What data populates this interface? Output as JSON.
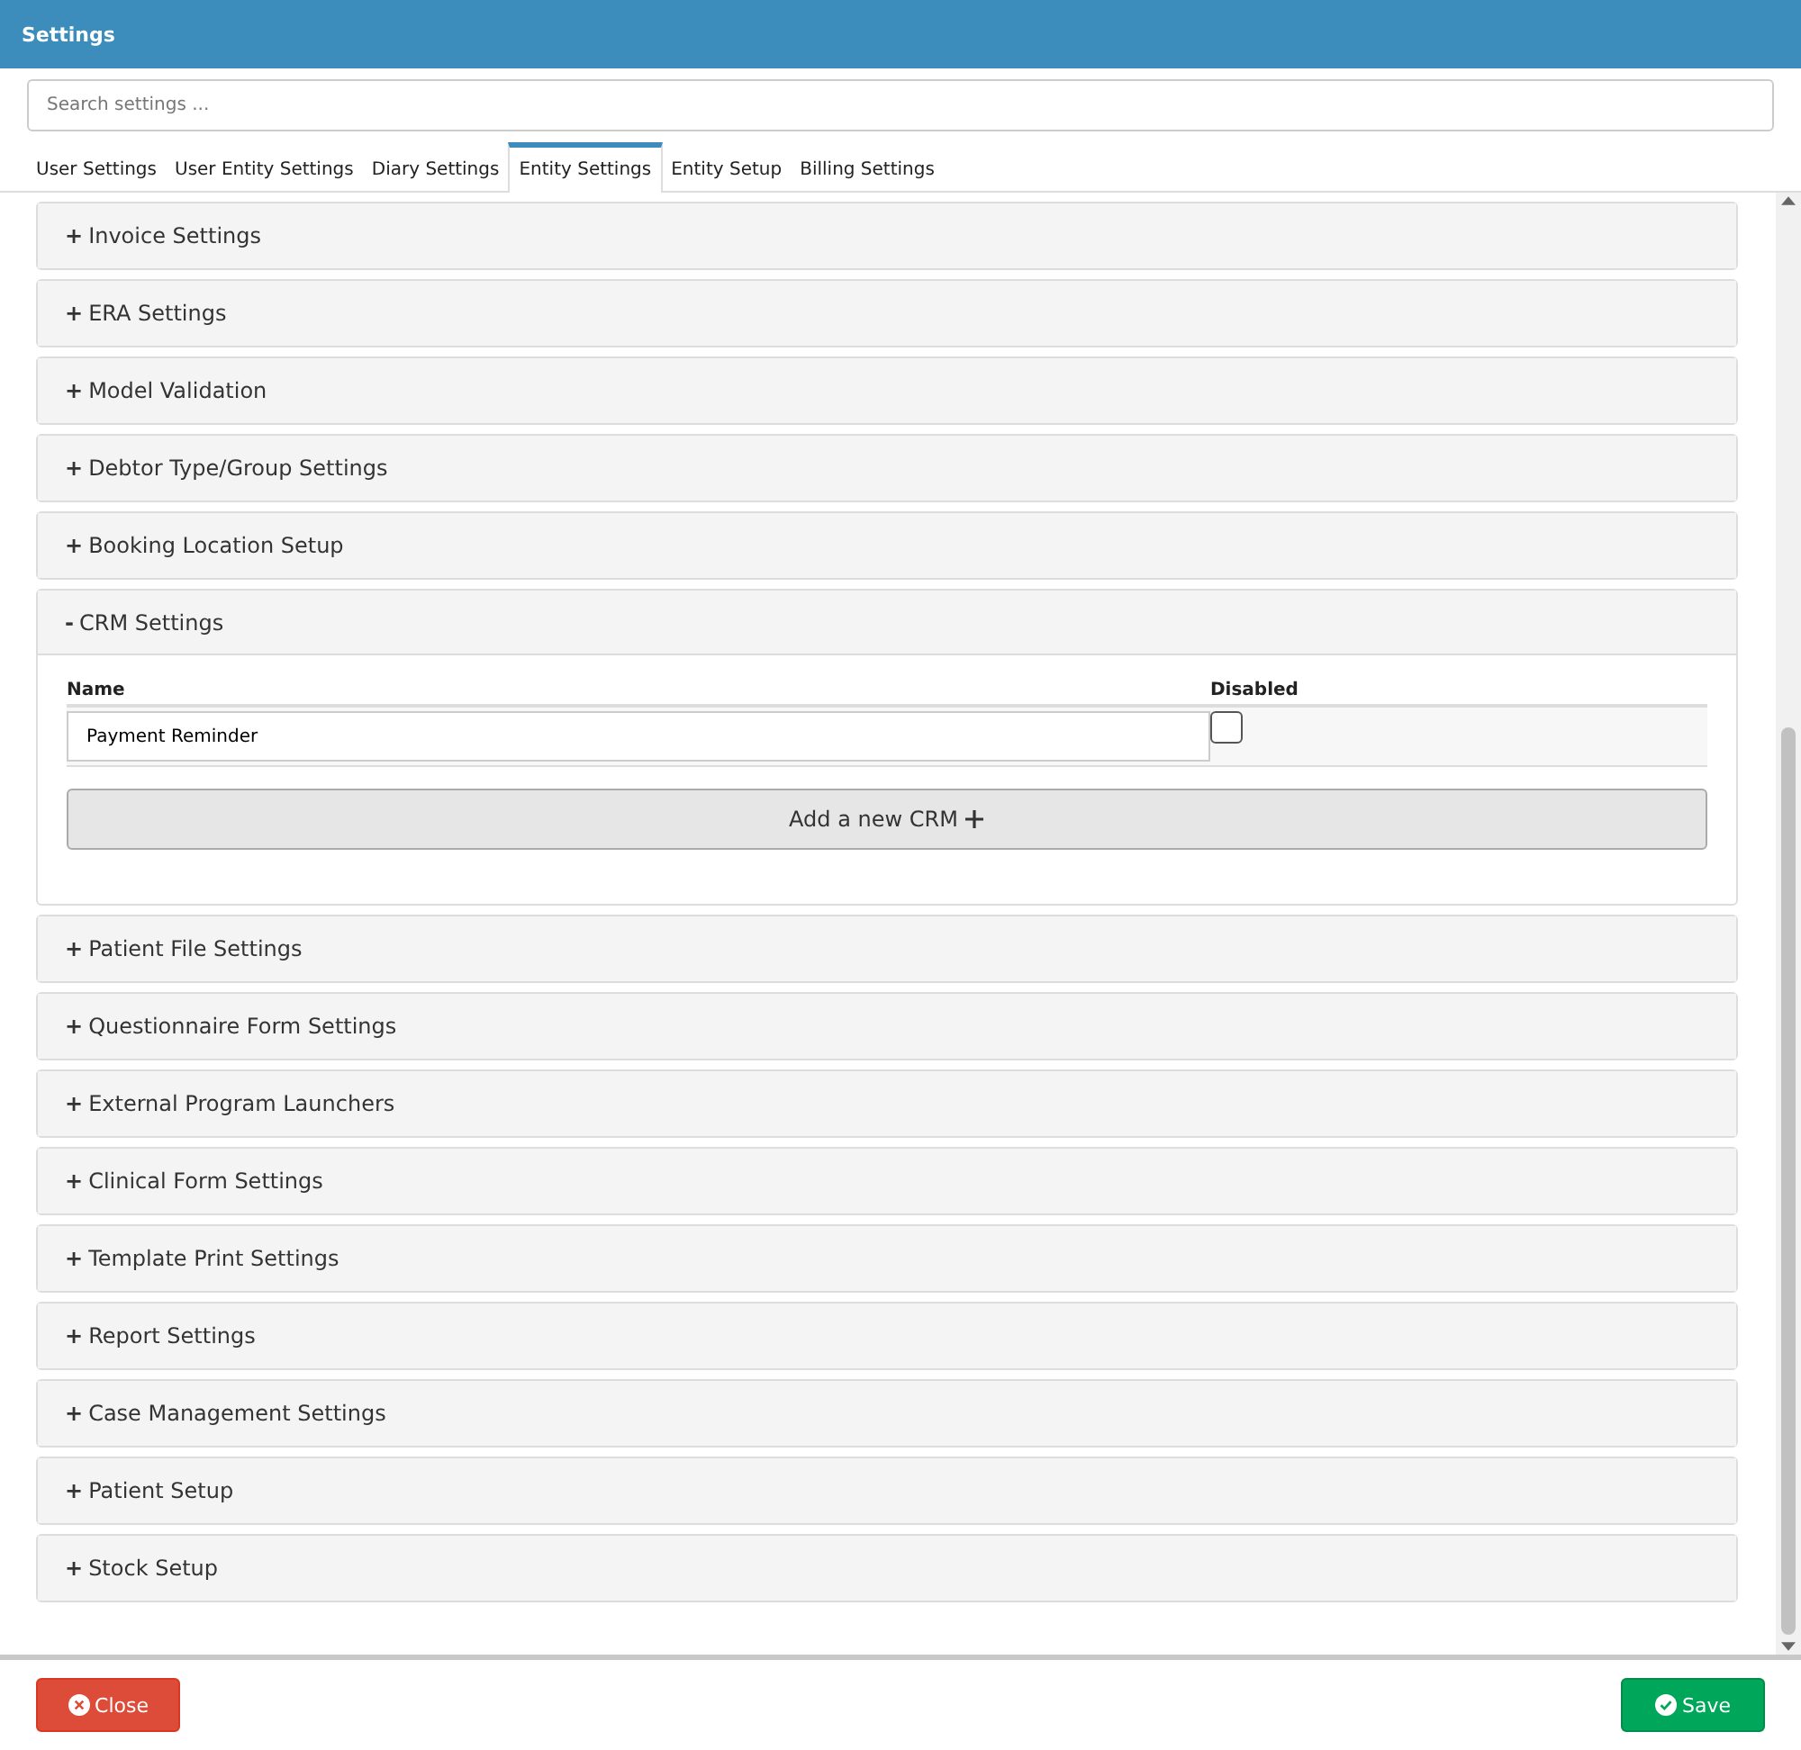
{
  "window": {
    "title": "Settings"
  },
  "search": {
    "placeholder": "Search settings ..."
  },
  "tabs": [
    {
      "label": "User Settings",
      "selected": false
    },
    {
      "label": "User Entity Settings",
      "selected": false
    },
    {
      "label": "Diary Settings",
      "selected": false
    },
    {
      "label": "Entity Settings",
      "selected": true
    },
    {
      "label": "Entity Setup",
      "selected": false
    },
    {
      "label": "Billing Settings",
      "selected": false
    }
  ],
  "panels": [
    {
      "toggle": "+",
      "title": "Invoice Settings",
      "expanded": false
    },
    {
      "toggle": "+",
      "title": "ERA Settings",
      "expanded": false
    },
    {
      "toggle": "+",
      "title": "Model Validation",
      "expanded": false
    },
    {
      "toggle": "+",
      "title": "Debtor Type/Group Settings",
      "expanded": false
    },
    {
      "toggle": "+",
      "title": "Booking Location Setup",
      "expanded": false
    },
    {
      "toggle": "-",
      "title": "CRM Settings",
      "expanded": true,
      "columns": [
        "Name",
        "Disabled"
      ],
      "rows": [
        {
          "name": "Payment Reminder",
          "disabled": false
        }
      ],
      "add_button": "Add a new CRM"
    },
    {
      "toggle": "+",
      "title": "Patient File Settings",
      "expanded": false
    },
    {
      "toggle": "+",
      "title": "Questionnaire Form Settings",
      "expanded": false
    },
    {
      "toggle": "+",
      "title": "External Program Launchers",
      "expanded": false
    },
    {
      "toggle": "+",
      "title": "Clinical Form Settings",
      "expanded": false
    },
    {
      "toggle": "+",
      "title": "Template Print Settings",
      "expanded": false
    },
    {
      "toggle": "+",
      "title": "Report Settings",
      "expanded": false
    },
    {
      "toggle": "+",
      "title": "Case Management Settings",
      "expanded": false
    },
    {
      "toggle": "+",
      "title": "Patient Setup",
      "expanded": false
    },
    {
      "toggle": "+",
      "title": "Stock Setup",
      "expanded": false
    }
  ],
  "footer": {
    "close": "Close",
    "save": "Save"
  }
}
